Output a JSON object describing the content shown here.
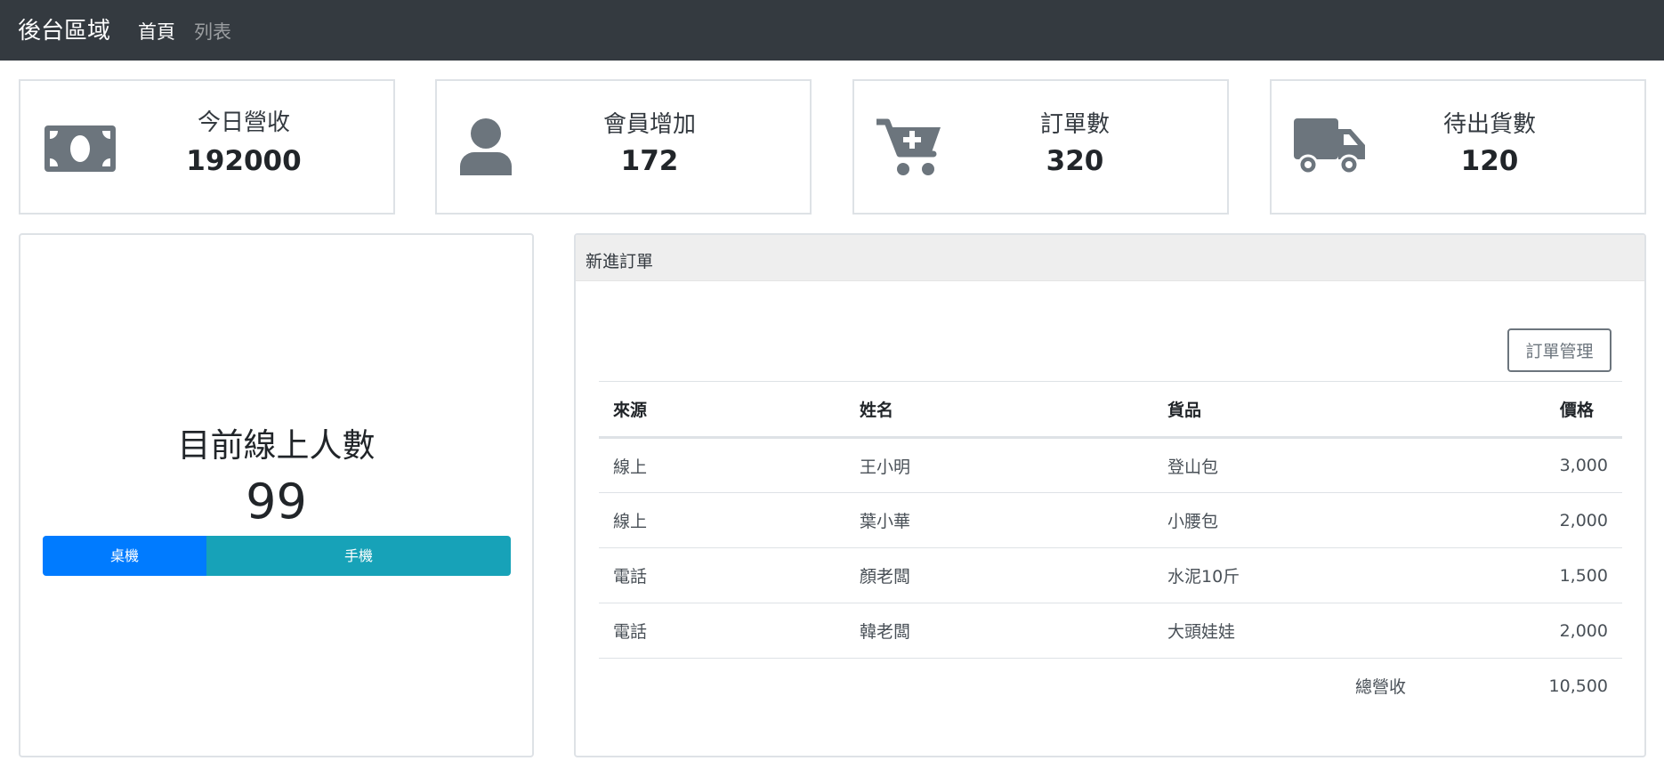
{
  "nav": {
    "brand": "後台區域",
    "links": [
      {
        "label": "首頁",
        "active": true
      },
      {
        "label": "列表",
        "active": false
      }
    ]
  },
  "stats": [
    {
      "icon": "money-icon",
      "label": "今日營收",
      "value": "192000"
    },
    {
      "icon": "user-icon",
      "label": "會員增加",
      "value": "172"
    },
    {
      "icon": "cart-plus-icon",
      "label": "訂單數",
      "value": "320"
    },
    {
      "icon": "truck-icon",
      "label": "待出貨數",
      "value": "120"
    }
  ],
  "online": {
    "title": "目前線上人數",
    "count": "99",
    "segments": [
      {
        "label": "桌機",
        "share": 0.35,
        "color": "#007bff"
      },
      {
        "label": "手機",
        "share": 0.65,
        "color": "#17a2b8"
      }
    ]
  },
  "orders": {
    "header": "新進訂單",
    "manage_button": "訂單管理",
    "columns": [
      "來源",
      "姓名",
      "貨品",
      "價格"
    ],
    "rows": [
      [
        "線上",
        "王小明",
        "登山包",
        "3,000"
      ],
      [
        "線上",
        "葉小華",
        "小腰包",
        "2,000"
      ],
      [
        "電話",
        "顏老闆",
        "水泥10斤",
        "1,500"
      ],
      [
        "電話",
        "韓老闆",
        "大頭娃娃",
        "2,000"
      ]
    ],
    "total_label": "總營收",
    "total_value": "10,500"
  },
  "colors": {
    "navbar": "#343a40",
    "icon": "#6c757d",
    "desktop": "#007bff",
    "mobile": "#17a2b8"
  }
}
